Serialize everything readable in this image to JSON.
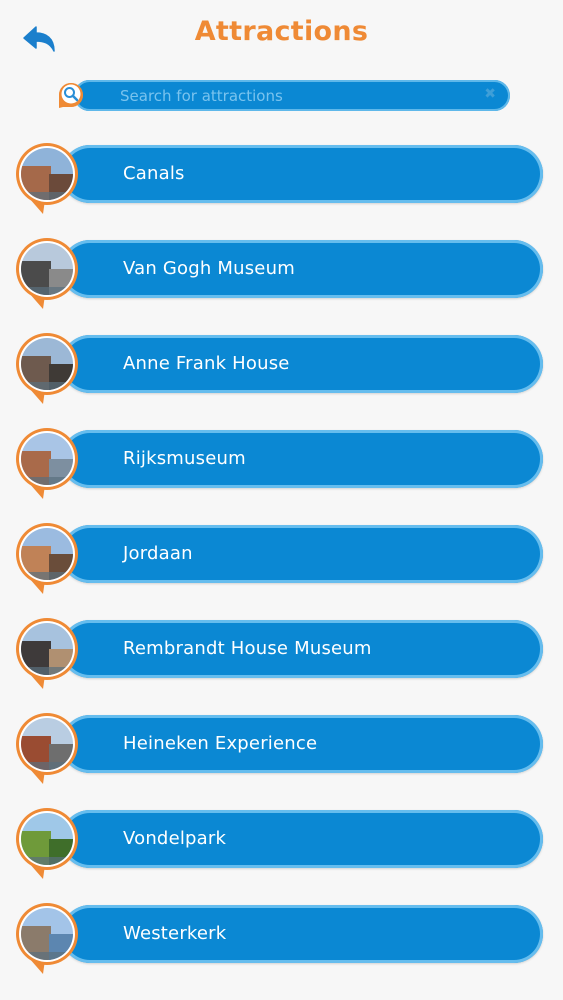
{
  "header": {
    "title": "Attractions",
    "back_icon": "back-arrow-icon"
  },
  "search": {
    "placeholder": "Search for attractions",
    "value": "",
    "clear_label": "✖",
    "icon": "search-icon"
  },
  "attractions": [
    {
      "label": "Canals"
    },
    {
      "label": "Van Gogh Museum"
    },
    {
      "label": "Anne Frank House"
    },
    {
      "label": "Rijksmuseum"
    },
    {
      "label": "Jordaan"
    },
    {
      "label": "Rembrandt House Museum"
    },
    {
      "label": "Heineken Experience"
    },
    {
      "label": "Vondelpark"
    },
    {
      "label": "Westerkerk"
    }
  ],
  "colors": {
    "accent_orange": "#ef8a35",
    "bar_blue": "#0b88d3",
    "bar_border": "#66bdee",
    "background": "#f7f7f7"
  }
}
